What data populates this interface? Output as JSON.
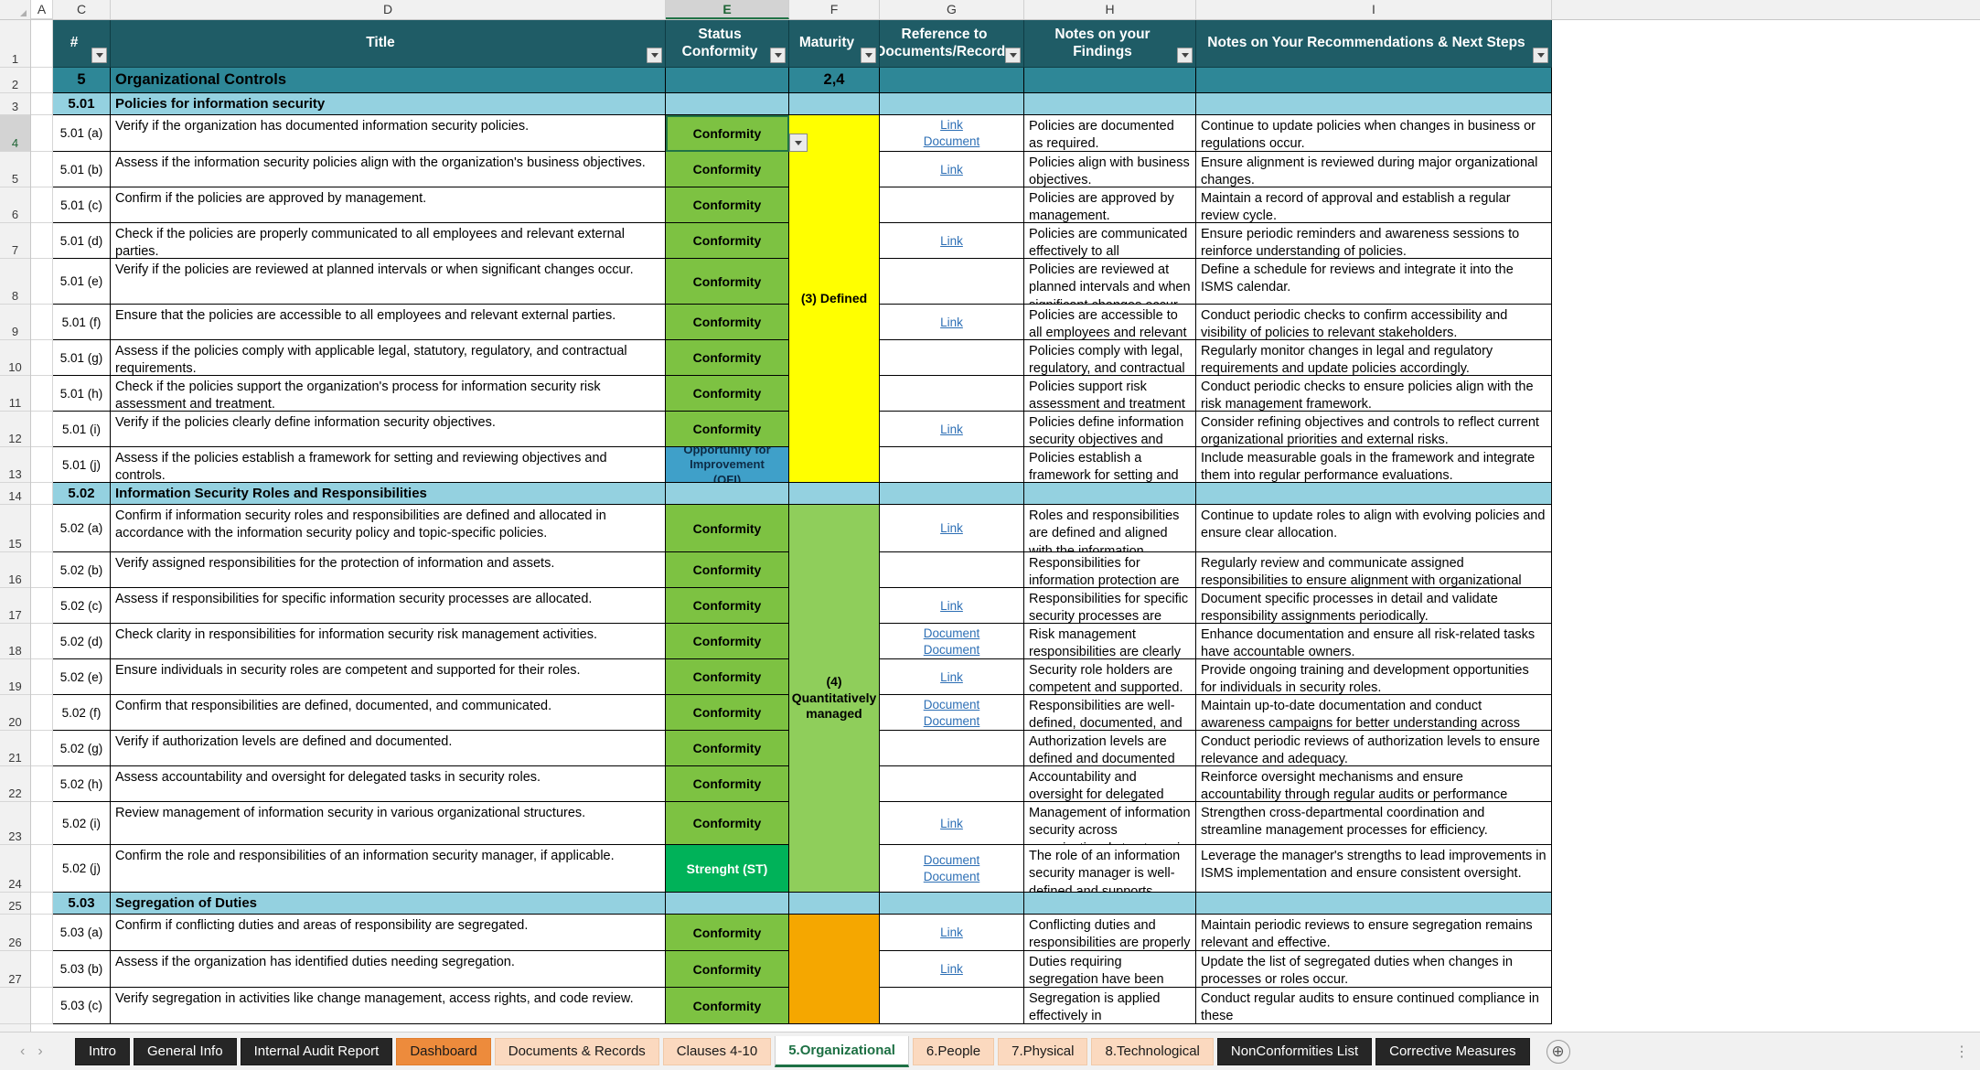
{
  "columns": {
    "letters": [
      "A",
      "C",
      "D",
      "E",
      "F",
      "G",
      "H",
      "I"
    ],
    "selected": "E"
  },
  "row_numbers": [
    "1",
    "2",
    "3",
    "4",
    "5",
    "6",
    "7",
    "8",
    "9",
    "10",
    "11",
    "12",
    "13",
    "14",
    "15",
    "16",
    "17",
    "18",
    "19",
    "20",
    "21",
    "22",
    "23",
    "24",
    "25",
    "26",
    "27"
  ],
  "selected_row": "4",
  "header": {
    "num": "#",
    "title": "Title",
    "status": "Status Conformity",
    "maturity": "Maturity",
    "reference": "Reference to Documents/Records",
    "findings": "Notes on your Findings",
    "recommendations": "Notes on Your Recommendations & Next Steps"
  },
  "section_main": {
    "num": "5",
    "title": "Organizational Controls",
    "maturity": "2,4"
  },
  "sections": [
    {
      "num": "5.01",
      "title": "Policies for information security",
      "maturity": "(3) Defined",
      "maturity_color": "#ffff00",
      "rows": [
        {
          "id": "5.01 (a)",
          "title": "Verify if the organization has documented information security policies.",
          "status": "Conformity",
          "status_kind": "conformity",
          "links": [
            "Link",
            "Document"
          ],
          "findings": "Policies are documented as required.",
          "recommendations": "Continue to update policies when changes in business or regulations occur."
        },
        {
          "id": "5.01 (b)",
          "title": "Assess if the information security policies align with the organization's business objectives.",
          "status": "Conformity",
          "status_kind": "conformity",
          "links": [
            "Link"
          ],
          "findings": "Policies align with business objectives.",
          "recommendations": "Ensure alignment is reviewed during major organizational changes."
        },
        {
          "id": "5.01 (c)",
          "title": "Confirm if the policies are approved by management.",
          "status": "Conformity",
          "status_kind": "conformity",
          "links": [],
          "findings": "Policies are approved by management.",
          "recommendations": "Maintain a record of approval and establish a regular review cycle."
        },
        {
          "id": "5.01 (d)",
          "title": "Check if the policies are properly communicated to all employees and relevant external parties.",
          "status": "Conformity",
          "status_kind": "conformity",
          "links": [
            "Link"
          ],
          "findings": "Policies are communicated effectively to all stakeholders.",
          "recommendations": "Ensure periodic reminders and awareness sessions to reinforce understanding of policies."
        },
        {
          "id": "5.01 (e)",
          "title": "Verify if the policies are reviewed at planned intervals or when significant changes occur.",
          "status": "Conformity",
          "status_kind": "conformity",
          "links": [],
          "findings": "Policies are reviewed at planned intervals and when significant changes occur.",
          "recommendations": "Define a schedule for reviews and integrate it into the ISMS calendar."
        },
        {
          "id": "5.01 (f)",
          "title": "Ensure that the policies are accessible to all employees and relevant external parties.",
          "status": "Conformity",
          "status_kind": "conformity",
          "links": [
            "Link"
          ],
          "findings": "Policies are accessible to all employees and relevant external parties.",
          "recommendations": "Conduct periodic checks to confirm accessibility and visibility of policies to relevant stakeholders."
        },
        {
          "id": "5.01 (g)",
          "title": "Assess if the policies comply with applicable legal, statutory, regulatory, and contractual requirements.",
          "status": "Conformity",
          "status_kind": "conformity",
          "links": [],
          "findings": "Policies comply with legal, regulatory, and contractual requirements.",
          "recommendations": "Regularly monitor changes in legal and regulatory requirements and update policies accordingly."
        },
        {
          "id": "5.01 (h)",
          "title": "Check if the policies support the organization's process for information security risk assessment and treatment.",
          "status": "Conformity",
          "status_kind": "conformity",
          "links": [],
          "findings": "Policies support risk assessment and treatment processes.",
          "recommendations": "Conduct periodic checks to ensure policies align with the risk management framework."
        },
        {
          "id": "5.01 (i)",
          "title": "Verify if the policies clearly define information security objectives.",
          "status": "Conformity",
          "status_kind": "conformity",
          "links": [
            "Link"
          ],
          "findings": "Policies define information security objectives and controls clearly.",
          "recommendations": "Consider refining objectives and controls to reflect current organizational priorities and external risks."
        },
        {
          "id": "5.01 (j)",
          "title": "Assess if the policies establish a framework for setting and reviewing objectives and controls.",
          "status": "Opportunity for Improvement (OFI)",
          "status_kind": "ofi",
          "links": [],
          "findings": "Policies establish a framework for setting and reviewing objectives.",
          "recommendations": "Include measurable goals in the framework and integrate them into regular performance evaluations."
        }
      ]
    },
    {
      "num": "5.02",
      "title": "Information Security Roles and Responsibilities",
      "maturity": "(4) Quantitatively managed",
      "maturity_color": "#8fce5b",
      "rows": [
        {
          "id": "5.02 (a)",
          "title": "Confirm if information security roles and responsibilities are defined and allocated in accordance with the information security policy and topic-specific policies.",
          "status": "Conformity",
          "status_kind": "conformity",
          "links": [
            "Link"
          ],
          "findings": "Roles and responsibilities are defined and aligned with the information security policy.",
          "recommendations": "Continue to update roles to align with evolving policies and ensure clear allocation."
        },
        {
          "id": "5.02 (b)",
          "title": "Verify assigned responsibilities for the protection of information and assets.",
          "status": "Conformity",
          "status_kind": "conformity",
          "links": [],
          "findings": "Responsibilities for information protection are assigned effectively.",
          "recommendations": "Regularly review and communicate assigned responsibilities to ensure alignment with organizational goals."
        },
        {
          "id": "5.02 (c)",
          "title": "Assess if responsibilities for specific information security processes are allocated.",
          "status": "Conformity",
          "status_kind": "conformity",
          "links": [
            "Link"
          ],
          "findings": "Responsibilities for specific security processes are allocated appropriately.",
          "recommendations": "Document specific processes in detail and validate responsibility assignments periodically."
        },
        {
          "id": "5.02 (d)",
          "title": "Check clarity in responsibilities for information security risk management activities.",
          "status": "Conformity",
          "status_kind": "conformity",
          "links": [
            "Document",
            "Document"
          ],
          "findings": "Risk management responsibilities are clearly defined.",
          "recommendations": "Enhance documentation and ensure all risk-related tasks have accountable owners."
        },
        {
          "id": "5.02 (e)",
          "title": "Ensure individuals in security roles are competent and supported for their roles.",
          "status": "Conformity",
          "status_kind": "conformity",
          "links": [
            "Link"
          ],
          "findings": "Security role holders are competent and supported.",
          "recommendations": "Provide ongoing training and development opportunities for individuals in security roles."
        },
        {
          "id": "5.02 (f)",
          "title": "Confirm that responsibilities are defined, documented, and communicated.",
          "status": "Conformity",
          "status_kind": "conformity",
          "links": [
            "Document",
            "Document"
          ],
          "findings": "Responsibilities are well-defined, documented, and communicated.",
          "recommendations": "Maintain up-to-date documentation and conduct awareness campaigns for better understanding across teams."
        },
        {
          "id": "5.02 (g)",
          "title": "Verify if authorization levels are defined and documented.",
          "status": "Conformity",
          "status_kind": "conformity",
          "links": [],
          "findings": "Authorization levels are defined and documented effectively.",
          "recommendations": "Conduct periodic reviews of authorization levels to ensure relevance and adequacy."
        },
        {
          "id": "5.02 (h)",
          "title": "Assess accountability and oversight for delegated tasks in security roles.",
          "status": "Conformity",
          "status_kind": "conformity",
          "links": [],
          "findings": "Accountability and oversight for delegated tasks are established.",
          "recommendations": "Reinforce oversight mechanisms and ensure accountability through regular audits or performance reviews."
        },
        {
          "id": "5.02 (i)",
          "title": "Review management of information security in various organizational structures.",
          "status": "Conformity",
          "status_kind": "conformity",
          "links": [
            "Link"
          ],
          "findings": "Management of information security across organizational structures is reviewed.",
          "recommendations": "Strengthen cross-departmental coordination and streamline management processes for efficiency."
        },
        {
          "id": "5.02 (j)",
          "title": "Confirm the role and responsibilities of an information security manager, if applicable.",
          "status": "Strenght (ST)",
          "status_kind": "strength",
          "links": [
            "Document",
            "Document"
          ],
          "findings": "The role of an information security manager is well-defined and supports organizational objectives.",
          "recommendations": "Leverage the manager's strengths to lead improvements in ISMS implementation and ensure consistent oversight."
        }
      ]
    },
    {
      "num": "5.03",
      "title": "Segregation of Duties",
      "maturity": "",
      "maturity_color": "#f5a700",
      "rows": [
        {
          "id": "5.03 (a)",
          "title": "Confirm if conflicting duties and areas of responsibility are segregated.",
          "status": "Conformity",
          "status_kind": "conformity",
          "links": [
            "Link"
          ],
          "findings": "Conflicting duties and responsibilities are properly segregated.",
          "recommendations": "Maintain periodic reviews to ensure segregation remains relevant and effective."
        },
        {
          "id": "5.03 (b)",
          "title": "Assess if the organization has identified duties needing segregation.",
          "status": "Conformity",
          "status_kind": "conformity",
          "links": [
            "Link"
          ],
          "findings": "Duties requiring segregation have been identified.",
          "recommendations": "Update the list of segregated duties when changes in processes or roles occur."
        },
        {
          "id": "5.03 (c)",
          "title": "Verify segregation in activities like change management, access rights, and code review.",
          "status": "Conformity",
          "status_kind": "conformity",
          "links": [],
          "findings": "Segregation is applied effectively in",
          "recommendations": "Conduct regular audits to ensure continued compliance in these"
        }
      ]
    }
  ],
  "tabs": [
    {
      "label": "Intro",
      "style": "dark"
    },
    {
      "label": "General Info",
      "style": "dark"
    },
    {
      "label": "Internal Audit Report",
      "style": "dark"
    },
    {
      "label": "Dashboard",
      "style": "orange"
    },
    {
      "label": "Documents & Records",
      "style": "peach"
    },
    {
      "label": "Clauses 4-10",
      "style": "peach"
    },
    {
      "label": "5.Organizational",
      "style": "active"
    },
    {
      "label": "6.People",
      "style": "peach"
    },
    {
      "label": "7.Physical",
      "style": "peach"
    },
    {
      "label": "8.Technological",
      "style": "peach"
    },
    {
      "label": "NonConformities List",
      "style": "dark"
    },
    {
      "label": "Corrective Measures",
      "style": "dark"
    }
  ],
  "tabbar": {
    "prev": "‹",
    "next": "›",
    "add": "⊕",
    "status_icons": "⋮"
  },
  "colors": {
    "header_teal": "#1f5c66",
    "section_main": "#2e8797",
    "section_sub": "#94d1e0",
    "conformity_green": "#7dc242",
    "ofi_blue": "#3fa0c9",
    "strength_green": "#00b259",
    "maturity_yellow": "#ffff00",
    "maturity_green": "#8fce5b",
    "maturity_orange": "#f5a700",
    "link_blue": "#2d6fb5",
    "tab_active": "#1d7044"
  }
}
